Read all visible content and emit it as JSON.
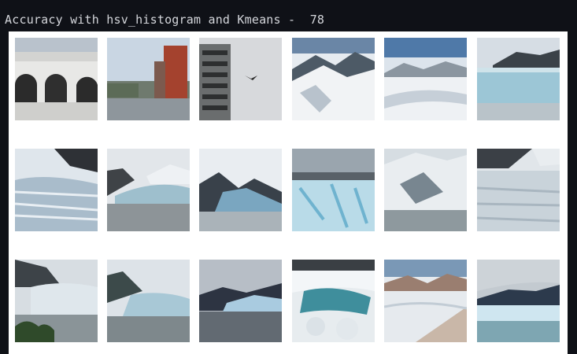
{
  "output": {
    "title": "Accuracy with hsv_histogram and Kmeans -  78"
  },
  "figure": {
    "images": [
      {
        "icon": "building-arches-photo"
      },
      {
        "icon": "waterfront-buildings-photo"
      },
      {
        "icon": "tower-bird-photo"
      },
      {
        "icon": "aerial-snow-mountains-photo"
      },
      {
        "icon": "icefield-photo"
      },
      {
        "icon": "glacier-face-photo"
      },
      {
        "icon": "crevassed-glacier-photo"
      },
      {
        "icon": "valley-glacier-photo"
      },
      {
        "icon": "glacier-bay-photo"
      },
      {
        "icon": "blue-ice-closeup-photo"
      },
      {
        "icon": "snowy-mountain-lake-photo"
      },
      {
        "icon": "glacier-terminus-photo"
      },
      {
        "icon": "glacier-lake-trees-photo"
      },
      {
        "icon": "glacier-valley-photo"
      },
      {
        "icon": "cloudy-glacier-water-photo"
      },
      {
        "icon": "ice-cave-photo"
      },
      {
        "icon": "aerial-icefield-photo"
      },
      {
        "icon": "glacier-sea-photo"
      }
    ]
  }
}
